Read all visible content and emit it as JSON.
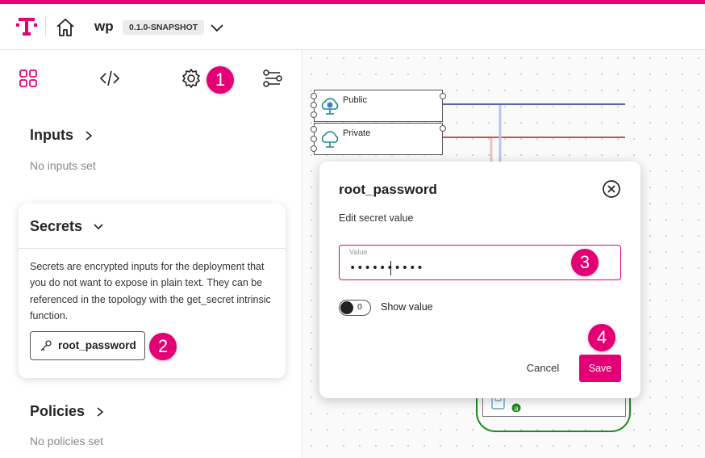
{
  "header": {
    "app_name": "wp",
    "version": "0.1.0-SNAPSHOT",
    "brand_color": "#e20074"
  },
  "toolbar": {
    "icons": [
      "grid-icon",
      "code-icon",
      "gear-icon",
      "topology-icon"
    ],
    "selected": "gear-icon"
  },
  "left_panel": {
    "inputs_title": "Inputs",
    "inputs_empty": "No inputs set",
    "secrets_title": "Secrets",
    "secrets_description": "Secrets are encrypted inputs for the deployment that you do not want to expose in plain text. They can be referenced in the topology with the get_secret intrinsic function.",
    "secret_items": [
      {
        "label": "root_password"
      }
    ],
    "policies_title": "Policies",
    "policies_empty": "No policies set"
  },
  "canvas": {
    "nodes": [
      {
        "label": "Public",
        "link_color": "#1a3a8f"
      },
      {
        "label": "Private",
        "link_color": "#b22222"
      }
    ],
    "hidden_node_badge": "a",
    "group_color": "#1f8a1f"
  },
  "dialog": {
    "title": "root_password",
    "subtitle": "Edit secret value",
    "field_label": "Value",
    "field_value": "••••••••••",
    "toggle_state": "0",
    "toggle_label": "Show value",
    "cancel_label": "Cancel",
    "save_label": "Save"
  },
  "step_badges": [
    "1",
    "2",
    "3",
    "4"
  ]
}
